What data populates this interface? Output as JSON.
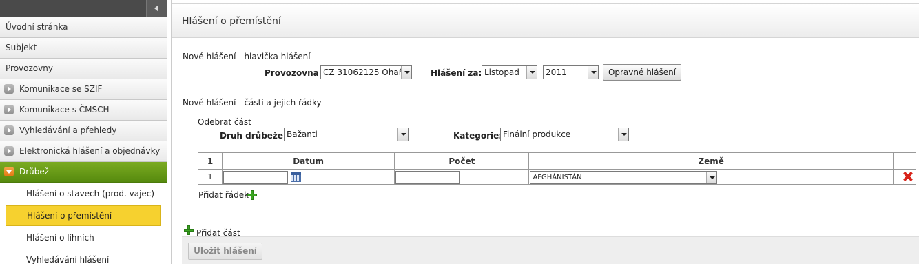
{
  "sidebar": {
    "items": [
      {
        "label": "Úvodní stránka"
      },
      {
        "label": "Subjekt"
      },
      {
        "label": "Provozovny"
      },
      {
        "label": "Komunikace se SZIF"
      },
      {
        "label": "Komunikace s ČMSCH"
      },
      {
        "label": "Vyhledávání a přehledy"
      },
      {
        "label": "Elektronická hlášení a objednávky"
      },
      {
        "label": "Drůbež"
      }
    ],
    "subitems": [
      {
        "label": "Hlášení o stavech (prod. vajec)"
      },
      {
        "label": "Hlášení o přemístění"
      },
      {
        "label": "Hlášení o líhních"
      },
      {
        "label": "Vyhledávání hlášení"
      }
    ],
    "active_color": "#6a9b19",
    "selected_color": "#f6d12f"
  },
  "page": {
    "title": "Hlášení o přemístění"
  },
  "header_section": {
    "label": "Nové hlášení - hlavička hlášení",
    "provozovna_label": "Provozovna:",
    "provozovna_value": "CZ 31062125 Ohař",
    "hlaseni_za_label": "Hlášení za:",
    "month_value": "Listopad",
    "year_value": "2011",
    "correction_button": "Opravné hlášení"
  },
  "parts_section": {
    "label": "Nové hlášení - části a jejich řádky",
    "remove_part": "Odebrat část",
    "druh_label": "Druh drůbeže:",
    "druh_value": "Bažanti",
    "kategorie_label": "Kategorie:",
    "kategorie_value": "Finální produkce",
    "table": {
      "headers": [
        "1",
        "Datum",
        "Počet",
        "Země",
        ""
      ],
      "rows": [
        {
          "index": "1",
          "datum": "",
          "pocet": "",
          "zeme": "AFGHÁNISTÁN"
        }
      ]
    },
    "add_row": "Přidat řádek",
    "add_part": "Přidat část"
  },
  "footer": {
    "save_button": "Uložit hlášení"
  }
}
